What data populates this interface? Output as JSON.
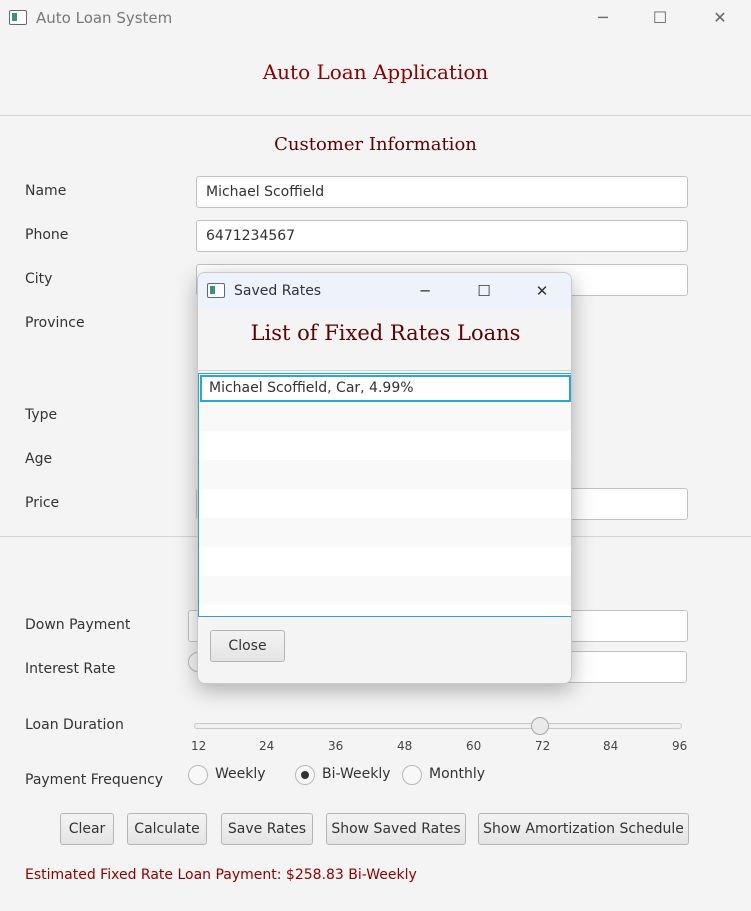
{
  "window": {
    "title": "Auto Loan System",
    "minimize_glyph": "─",
    "maximize_glyph": "☐",
    "close_glyph": "✕"
  },
  "app_heading": "Auto Loan Application",
  "customer_section": {
    "heading": "Customer Information",
    "name_label": "Name",
    "name_value": "Michael Scoffield",
    "phone_label": "Phone",
    "phone_value": "6471234567",
    "city_label": "City",
    "province_label": "Province"
  },
  "vehicle_section": {
    "type_label": "Type",
    "age_label": "Age",
    "price_label": "Price"
  },
  "loan_section": {
    "down_payment_label": "Down Payment",
    "interest_rate_label": "Interest Rate",
    "loan_duration_label": "Loan Duration",
    "slider": {
      "min": 12,
      "max": 96,
      "value": 72,
      "ticks": [
        "12",
        "24",
        "36",
        "48",
        "60",
        "72",
        "84",
        "96"
      ]
    },
    "payment_frequency_label": "Payment Frequency",
    "frequency_options": [
      "Weekly",
      "Bi-Weekly",
      "Monthly"
    ],
    "frequency_selected": "Bi-Weekly"
  },
  "buttons": {
    "clear": "Clear",
    "calculate": "Calculate",
    "save_rates": "Save Rates",
    "show_saved_rates": "Show Saved Rates",
    "show_amortization": "Show Amortization Schedule"
  },
  "estimate_text": "Estimated Fixed Rate Loan Payment: $258.83 Bi-Weekly",
  "dialog": {
    "title": "Saved Rates",
    "heading": "List of Fixed Rates Loans",
    "items": [
      "Michael Scoffield, Car, 4.99%"
    ],
    "close_label": "Close",
    "minimize_glyph": "─",
    "maximize_glyph": "☐",
    "close_glyph": "✕"
  },
  "colors": {
    "accent": "#8b0000",
    "section_heading": "#5c0000",
    "focus": "#2aa5d8"
  }
}
